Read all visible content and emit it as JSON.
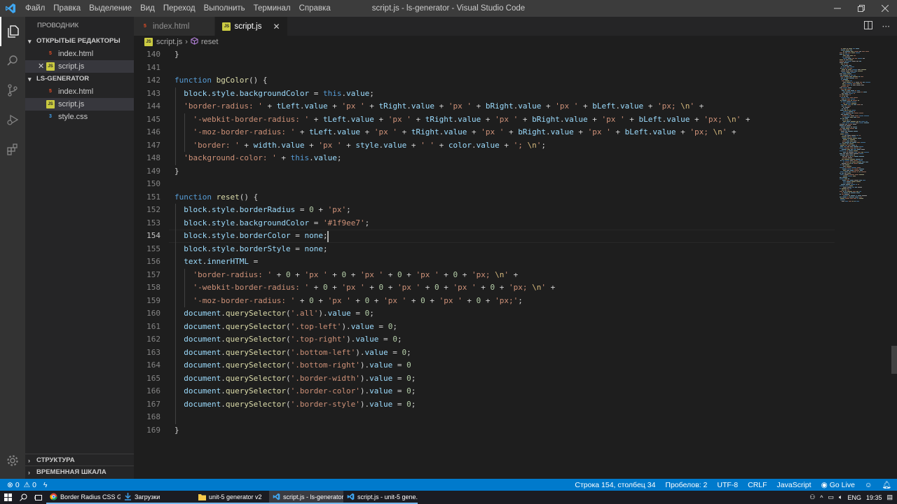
{
  "window": {
    "title": "script.js - ls-generator - Visual Studio Code",
    "menu": [
      "Файл",
      "Правка",
      "Выделение",
      "Вид",
      "Переход",
      "Выполнить",
      "Терминал",
      "Справка"
    ]
  },
  "sidebar": {
    "title": "ПРОВОДНИК",
    "open_editors_title": "ОТКРЫТЫЕ РЕДАКТОРЫ",
    "open_editors": [
      {
        "name": "index.html",
        "type": "html"
      },
      {
        "name": "script.js",
        "type": "js"
      }
    ],
    "folder_title": "LS-GENERATOR",
    "files": [
      {
        "name": "index.html",
        "type": "html"
      },
      {
        "name": "script.js",
        "type": "js"
      },
      {
        "name": "style.css",
        "type": "css"
      }
    ],
    "structure_title": "СТРУКТУРА",
    "timeline_title": "ВРЕМЕННАЯ ШКАЛА"
  },
  "tabs": [
    {
      "label": "index.html",
      "type": "html",
      "active": false
    },
    {
      "label": "script.js",
      "type": "js",
      "active": true
    }
  ],
  "breadcrumb": {
    "file": "script.js",
    "symbol": "reset"
  },
  "editor": {
    "current_line": 154,
    "lines": [
      {
        "n": 140,
        "t": "}"
      },
      {
        "n": 141,
        "t": ""
      },
      {
        "n": 142,
        "t": "function bgColor() {"
      },
      {
        "n": 143,
        "t": "  block.style.backgroundColor = this.value;"
      },
      {
        "n": 144,
        "t": "  'border-radius: ' + tLeft.value + 'px ' + tRight.value + 'px ' + bRight.value + 'px ' + bLeft.value + 'px; \\n' +"
      },
      {
        "n": 145,
        "t": "    '-webkit-border-radius: ' + tLeft.value + 'px ' + tRight.value + 'px ' + bRight.value + 'px ' + bLeft.value + 'px; \\n' +"
      },
      {
        "n": 146,
        "t": "    '-moz-border-radius: ' + tLeft.value + 'px ' + tRight.value + 'px ' + bRight.value + 'px ' + bLeft.value + 'px; \\n' +"
      },
      {
        "n": 147,
        "t": "    'border: ' + width.value + 'px ' + style.value + ' ' + color.value + '; \\n';"
      },
      {
        "n": 148,
        "t": "  'background-color: ' + this.value;"
      },
      {
        "n": 149,
        "t": "}"
      },
      {
        "n": 150,
        "t": ""
      },
      {
        "n": 151,
        "t": "function reset() {"
      },
      {
        "n": 152,
        "t": "  block.style.borderRadius = 0 + 'px';"
      },
      {
        "n": 153,
        "t": "  block.style.backgroundColor = '#1f9ee7';"
      },
      {
        "n": 154,
        "t": "  block.style.borderColor = none;"
      },
      {
        "n": 155,
        "t": "  block.style.borderStyle = none;"
      },
      {
        "n": 156,
        "t": "  text.innerHTML ="
      },
      {
        "n": 157,
        "t": "    'border-radius: ' + 0 + 'px ' + 0 + 'px ' + 0 + 'px ' + 0 + 'px; \\n' +"
      },
      {
        "n": 158,
        "t": "    '-webkit-border-radius: ' + 0 + 'px ' + 0 + 'px ' + 0 + 'px ' + 0 + 'px; \\n' +"
      },
      {
        "n": 159,
        "t": "    '-moz-border-radius: ' + 0 + 'px ' + 0 + 'px ' + 0 + 'px ' + 0 + 'px;';"
      },
      {
        "n": 160,
        "t": "  document.querySelector('.all').value = 0;"
      },
      {
        "n": 161,
        "t": "  document.querySelector('.top-left').value = 0;"
      },
      {
        "n": 162,
        "t": "  document.querySelector('.top-right').value = 0;"
      },
      {
        "n": 163,
        "t": "  document.querySelector('.bottom-left').value = 0;"
      },
      {
        "n": 164,
        "t": "  document.querySelector('.bottom-right').value = 0"
      },
      {
        "n": 165,
        "t": "  document.querySelector('.border-width').value = 0;"
      },
      {
        "n": 166,
        "t": "  document.querySelector('.border-color').value = 0;"
      },
      {
        "n": 167,
        "t": "  document.querySelector('.border-style').value = 0;"
      },
      {
        "n": 168,
        "t": ""
      },
      {
        "n": 169,
        "t": "}"
      }
    ]
  },
  "status": {
    "errors": "0",
    "warnings": "0",
    "position": "Строка 154, столбец 34",
    "spaces": "Пробелов: 2",
    "encoding": "UTF-8",
    "eol": "CRLF",
    "language": "JavaScript",
    "golive": "Go Live"
  },
  "taskbar": {
    "apps": [
      {
        "label": "Border Radius CSS Ge...",
        "icon": "chrome-icon",
        "active": false
      },
      {
        "label": "Загрузки",
        "icon": "download-icon",
        "active": false
      },
      {
        "label": "unit-5 generator v2",
        "icon": "folder-icon",
        "active": false
      },
      {
        "label": "script.js - ls-generator...",
        "icon": "vscode-icon",
        "active": true
      },
      {
        "label": "script.js - unit-5 gene...",
        "icon": "vscode-icon",
        "active": false
      }
    ],
    "lang": "ENG",
    "time": "19:35"
  },
  "colors": {
    "keyword": "#569cd6",
    "function": "#dcdcaa",
    "string": "#ce9178",
    "variable": "#9cdcfe",
    "number": "#b5cea8",
    "escape": "#d7ba7d",
    "accent": "#007acc"
  }
}
